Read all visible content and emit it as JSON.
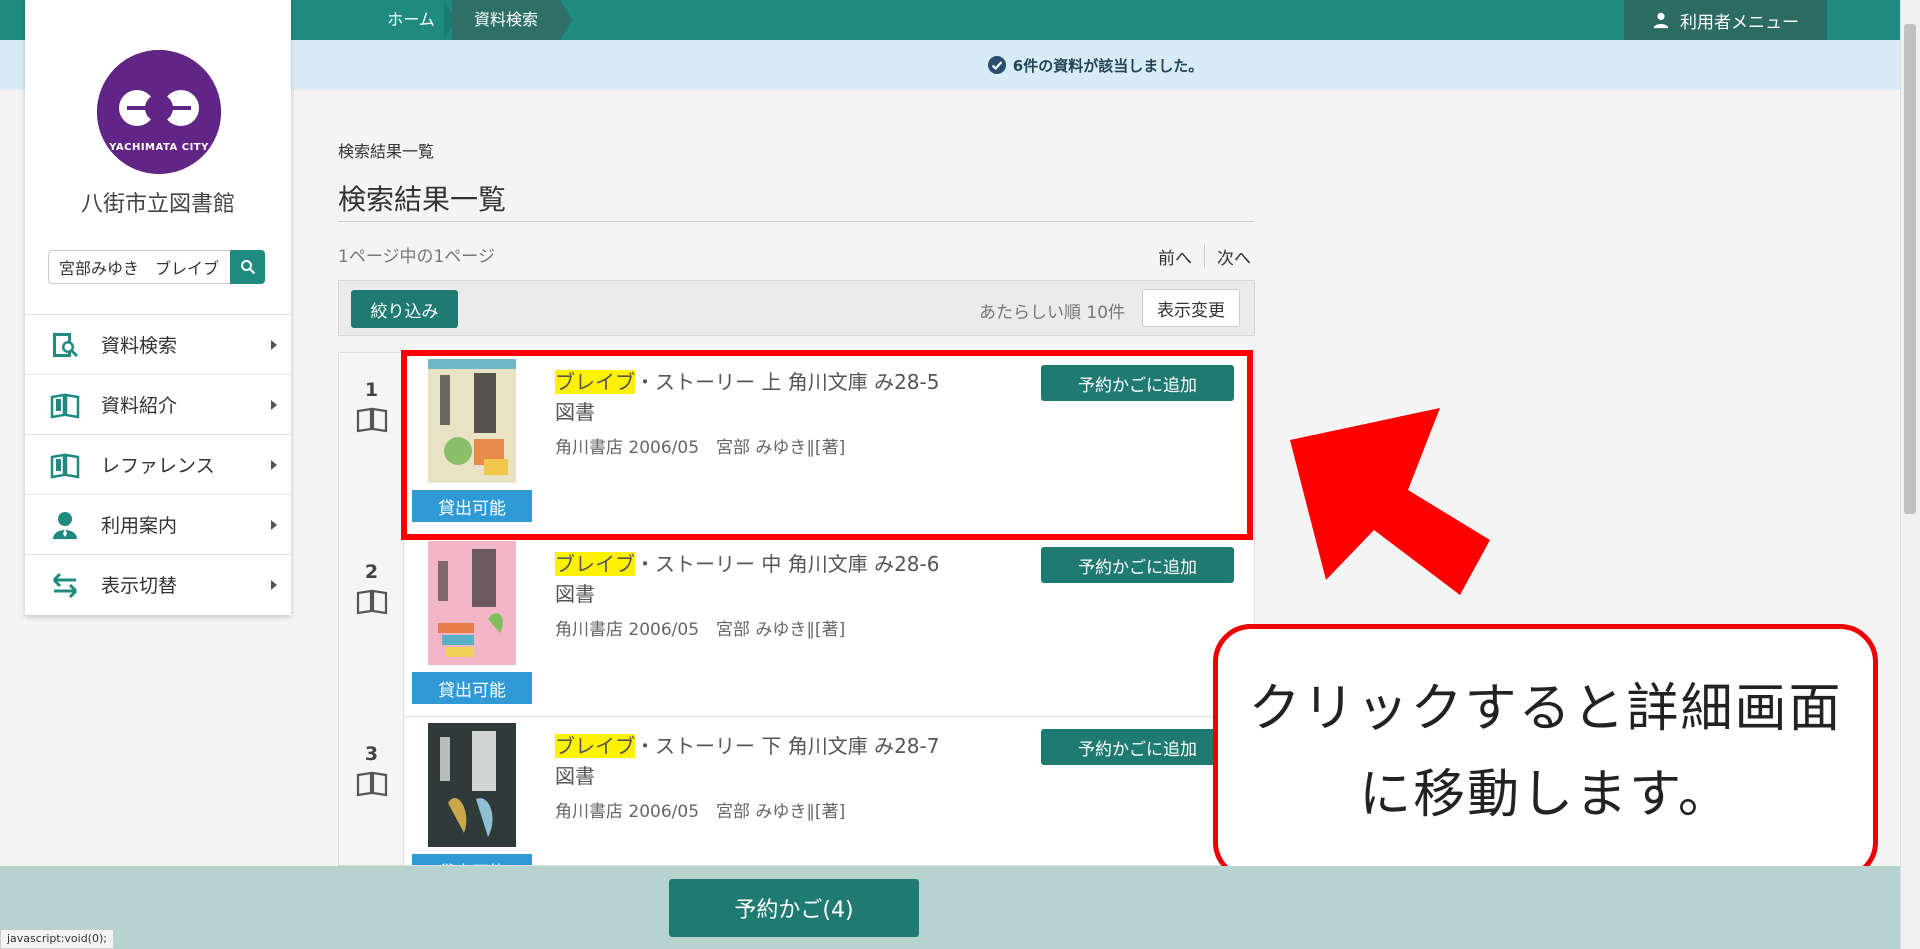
{
  "header": {
    "breadcrumb_home": "ホーム",
    "breadcrumb_current": "資料検索",
    "user_menu": "利用者メニュー"
  },
  "notice": {
    "text": "6件の資料が該当しました。"
  },
  "sidebar": {
    "logo_text": "YACHIMATA CITY",
    "library_name": "八街市立図書館",
    "search_value": "宮部みゆき　ブレイブ",
    "nav": [
      {
        "label": "資料検索",
        "icon": "book-search-icon"
      },
      {
        "label": "資料紹介",
        "icon": "open-book-icon"
      },
      {
        "label": "レファレンス",
        "icon": "open-book-icon"
      },
      {
        "label": "利用案内",
        "icon": "person-icon"
      },
      {
        "label": "表示切替",
        "icon": "swap-arrows-icon"
      }
    ]
  },
  "main": {
    "breadcrumb_text": "検索結果一覧",
    "title": "検索結果一覧",
    "page_count": "1ページ中の1ページ",
    "prev": "前へ",
    "next": "次へ",
    "filter_button": "絞り込み",
    "sort_text": "あたらしい順 10件",
    "display_button": "表示変更",
    "results": [
      {
        "num": "1",
        "title_highlight": "ブレイブ",
        "title_rest": "・ストーリー 上 角川文庫 み28-5 図書",
        "meta": "角川書店 2006/05　宮部 みゆき∥[著]",
        "availability": "貸出可能",
        "reserve": "予約かごに追加",
        "cover_color": "#e9e2c4"
      },
      {
        "num": "2",
        "title_highlight": "ブレイブ",
        "title_rest": "・ストーリー 中 角川文庫 み28-6 図書",
        "meta": "角川書店 2006/05　宮部 みゆき∥[著]",
        "availability": "貸出可能",
        "reserve": "予約かごに追加",
        "cover_color": "#f2b6c8"
      },
      {
        "num": "3",
        "title_highlight": "ブレイブ",
        "title_rest": "・ストーリー 下 角川文庫 み28-7 図書",
        "meta": "角川書店 2006/05　宮部 みゆき∥[著]",
        "availability": "貸出可能",
        "reserve": "予約かごに追加",
        "cover_color": "#2f3a3a"
      }
    ]
  },
  "callout": {
    "line1": "クリックすると詳細画面",
    "line2": "に移動します。"
  },
  "footer": {
    "cart_button": "予約かご(4)",
    "status_url": "javascript:void(0);"
  },
  "colors": {
    "teal": "#1f8a80",
    "dark_teal": "#1f7a72",
    "available_blue": "#2f9ad6",
    "highlight": "#fff200",
    "annotation_red": "#ff0000",
    "logo_purple": "#612585"
  }
}
